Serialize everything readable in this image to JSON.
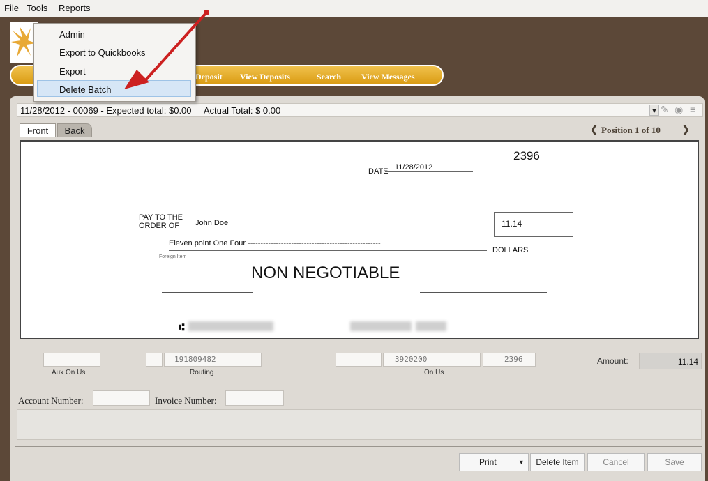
{
  "menubar": {
    "items": [
      "File",
      "Tools",
      "Reports"
    ]
  },
  "tools_menu": {
    "items": [
      "Admin",
      "Export to Quickbooks",
      "Export",
      "Delete Batch"
    ],
    "highlighted": "Delete Batch"
  },
  "nav": {
    "links": [
      "Deposit",
      "View Deposits",
      "Search",
      "View Messages"
    ]
  },
  "batch": {
    "date_id": "11/28/2012 - 00069 -",
    "expected": "Expected total: $0.00",
    "actual": "Actual Total: $ 0.00"
  },
  "tabs": {
    "front": "Front",
    "back": "Back"
  },
  "position": {
    "label": "Position 1 of 10"
  },
  "check": {
    "number": "2396",
    "date_label": "DATE",
    "date_value": "11/28/2012",
    "pay_to_line1": "PAY TO THE",
    "pay_to_line2": "ORDER OF",
    "payee": "John Doe",
    "amount_box": "11.14",
    "written_amount": "Eleven point One Four ----------------------------------------------------",
    "dollars": "DOLLARS",
    "foreign_item": "Foreign Item",
    "non_negotiable": "NON NEGOTIABLE"
  },
  "micr": {
    "aux_on_us_label": "Aux On Us",
    "routing_label": "Routing",
    "routing_value": "191809482",
    "on_us_label": "On Us",
    "on_us_value": "3920200",
    "serial_value": "2396",
    "amount_label": "Amount:",
    "amount_value": "11.14"
  },
  "fields": {
    "account_number": "Account Number:",
    "invoice_number": "Invoice Number:"
  },
  "buttons": {
    "print": "Print",
    "delete_item": "Delete Item",
    "cancel": "Cancel",
    "save": "Save"
  },
  "colors": {
    "app_bg": "#5c4838",
    "nav_gold": "#e2a524",
    "arrow": "#cc2020"
  }
}
